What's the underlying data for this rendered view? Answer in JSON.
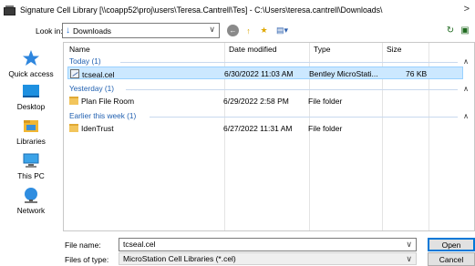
{
  "window": {
    "title": "Signature Cell Library [\\\\coapp52\\proj\\users\\Teresa.Cantrell\\Tes] - C:\\Users\\teresa.cantrell\\Downloads\\",
    "close_glyph": ">"
  },
  "nav": {
    "look_in_label": "Look in:",
    "look_in_value": "Downloads"
  },
  "places": [
    {
      "label": "Quick access",
      "icon": "quick-access-star-icon"
    },
    {
      "label": "Desktop",
      "icon": "desktop-icon"
    },
    {
      "label": "Libraries",
      "icon": "libraries-icon"
    },
    {
      "label": "This PC",
      "icon": "this-pc-icon"
    },
    {
      "label": "Network",
      "icon": "network-icon"
    }
  ],
  "columns": {
    "name": "Name",
    "date": "Date modified",
    "type": "Type",
    "size": "Size"
  },
  "groups": [
    {
      "label": "Today (1)",
      "files": [
        {
          "name": "tcseal.cel",
          "date": "6/30/2022 11:03 AM",
          "type": "Bentley MicroStati...",
          "size": "76 KB",
          "icon": "cel-file-icon",
          "selected": true
        }
      ]
    },
    {
      "label": "Yesterday (1)",
      "files": [
        {
          "name": "Plan File Room",
          "date": "6/29/2022 2:58 PM",
          "type": "File folder",
          "size": "",
          "icon": "folder-icon",
          "selected": false
        }
      ]
    },
    {
      "label": "Earlier this week (1)",
      "files": [
        {
          "name": "IdenTrust",
          "date": "6/27/2022 11:31 AM",
          "type": "File folder",
          "size": "",
          "icon": "folder-icon",
          "selected": false
        }
      ]
    }
  ],
  "bottom": {
    "file_name_label": "File name:",
    "file_name_value": "tcseal.cel",
    "file_type_label": "Files of type:",
    "file_type_value": "MicroStation Cell Libraries (*.cel)",
    "open_label": "Open",
    "cancel_label": "Cancel"
  },
  "colors": {
    "selection": "#cce8ff",
    "group_text": "#1f5fb0",
    "primary_border": "#0078d7"
  }
}
